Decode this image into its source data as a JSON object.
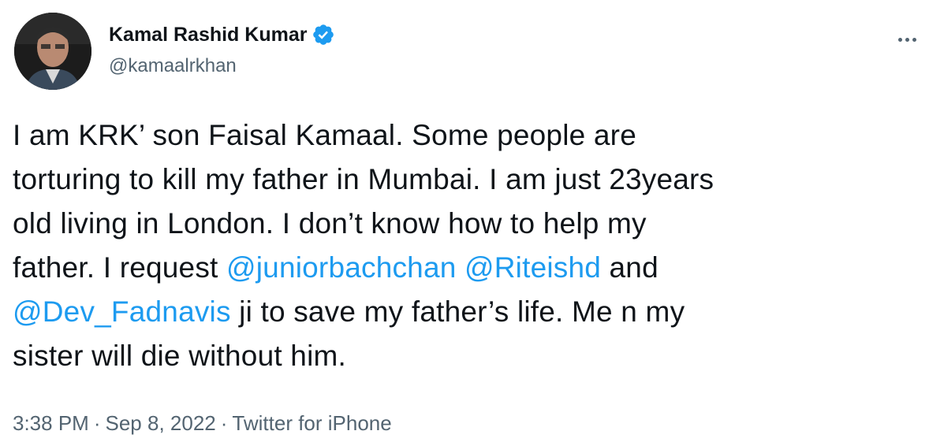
{
  "author": {
    "display_name": "Kamal Rashid Kumar",
    "handle": "@kamaalrkhan",
    "verified": true
  },
  "tweet": {
    "line1": "I am KRK’ son Faisal Kamaal. Some people are",
    "line2": "torturing to kill my father in Mumbai. I am just 23years",
    "line3": "old living in London. I don’t know how to help my",
    "line4_prefix": "father. I request ",
    "mention1": "@juniorbachchan",
    "mention2": "@Riteishd",
    "line4_suffix": " and",
    "mention3": "@Dev_Fadnavis",
    "line5_suffix": " ji to save my father’s life. Me n my",
    "line6": "sister will die without him."
  },
  "meta": {
    "time": "3:38 PM",
    "date": "Sep 8, 2022",
    "source": "Twitter for iPhone",
    "separator": "·"
  },
  "colors": {
    "text": "#0f1419",
    "secondary": "#536471",
    "accent": "#1d9bf0"
  }
}
